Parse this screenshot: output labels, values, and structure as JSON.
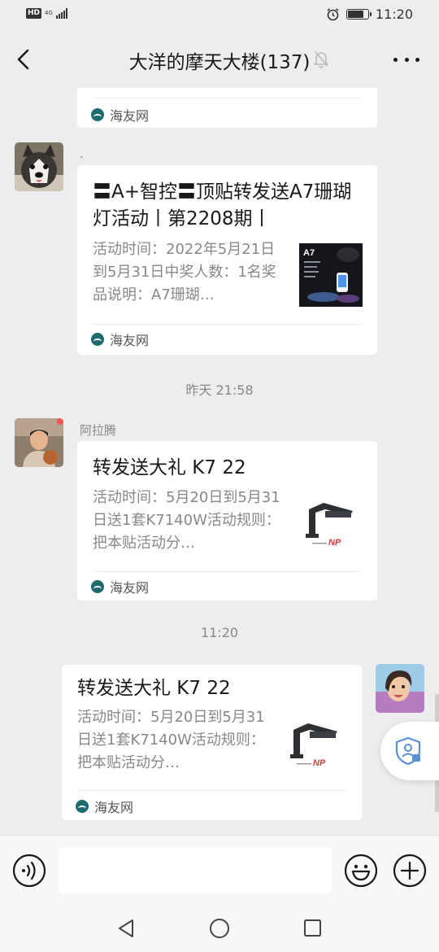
{
  "status_bar": {
    "hd_label": "HD",
    "network_label": "4G",
    "time": "11:20",
    "battery_level": 0.8
  },
  "header": {
    "title": "大洋的摩天大楼(137)",
    "back_icon": "chevron-left-icon",
    "mute_icon": "bell-off-icon",
    "more_icon": "more-dots-icon"
  },
  "messages": {
    "partial": {
      "source": "海友网"
    },
    "m1": {
      "sender": ".",
      "title": "〓A+智控〓顶贴转发送A7珊瑚灯活动丨第2208期丨",
      "description": "活动时间：2022年5月21日到5月31日中奖人数：1名奖品说明：A7珊瑚…",
      "thumb_label": "A7",
      "source": "海友网"
    },
    "ts1": "昨天 21:58",
    "m2": {
      "sender": "阿拉腾",
      "title": "转发送大礼 K7 22",
      "description": "活动时间：5月20日到5月31日送1套K7140W活动规则：把本贴活动分…",
      "source": "海友网"
    },
    "ts2": "11:20",
    "m3": {
      "title": "转发送大礼 K7 22",
      "description": "活动时间：5月20日到5月31日送1套K7140W活动规则：把本贴活动分…",
      "source": "海友网"
    }
  },
  "input_bar": {
    "voice_icon": "voice-icon",
    "input_value": "",
    "emoji_icon": "emoji-icon",
    "plus_icon": "plus-circle-icon"
  },
  "nav": {
    "back_icon": "triangle-back-icon",
    "home_icon": "circle-home-icon",
    "recent_icon": "square-recent-icon"
  },
  "colors": {
    "background": "#ededed",
    "bubble": "#ffffff",
    "muted_text": "#888888",
    "source_icon": "#1d6a6f"
  }
}
